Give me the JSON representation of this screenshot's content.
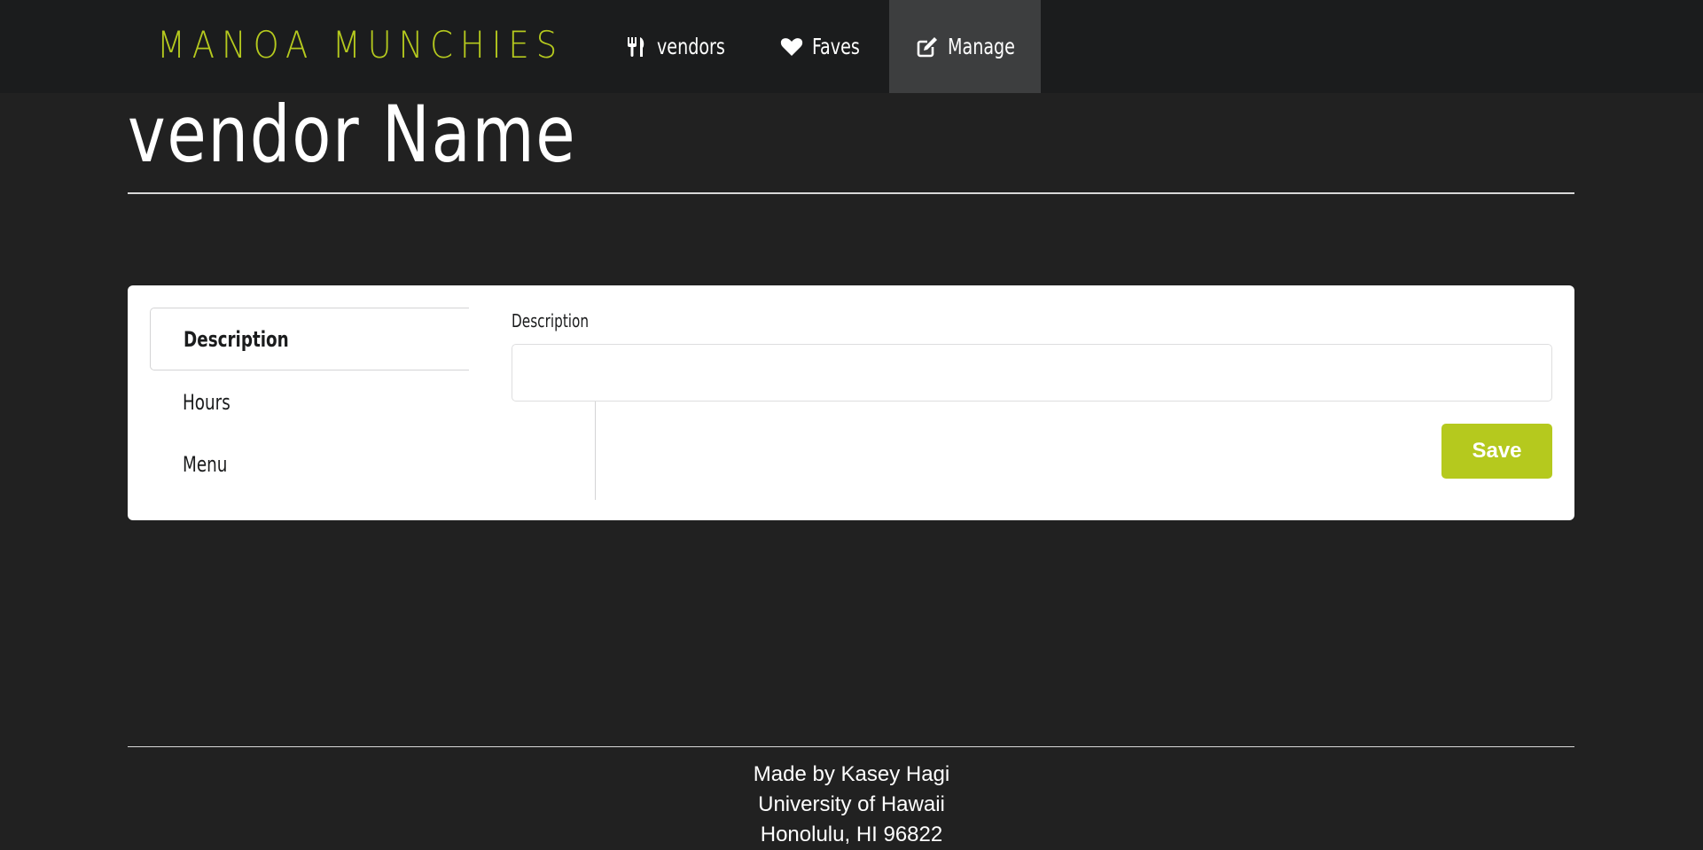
{
  "navbar": {
    "brand": "MANOA MUNCHIES",
    "items": [
      {
        "label": "vendors",
        "icon": "utensils-icon"
      },
      {
        "label": "Faves",
        "icon": "heart-icon"
      },
      {
        "label": "Manage",
        "icon": "edit-icon",
        "active": true
      }
    ]
  },
  "page": {
    "title": "vendor Name"
  },
  "card": {
    "tabs": [
      {
        "label": "Description",
        "active": true
      },
      {
        "label": "Hours"
      },
      {
        "label": "Menu"
      }
    ],
    "field": {
      "label": "Description",
      "value": "",
      "placeholder": ""
    },
    "save_label": "Save"
  },
  "footer": {
    "lines": [
      "Made by Kasey Hagi",
      "University of Hawaii",
      "Honolulu, HI 96822"
    ]
  },
  "colors": {
    "accent": "#b5c91e",
    "background": "#212121",
    "navbar": "#1b1c1d",
    "nav_active": "#3d3e3f"
  }
}
